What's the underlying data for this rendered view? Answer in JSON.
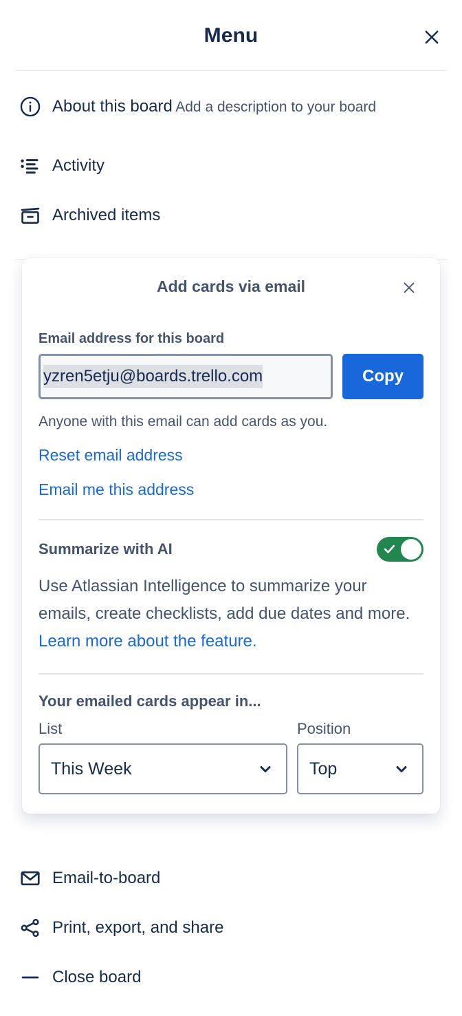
{
  "header": {
    "title": "Menu",
    "close_icon": "close-icon"
  },
  "menu": {
    "items_top": [
      {
        "icon": "info-circle-icon",
        "label": "About this board",
        "sublabel": "Add a description to your board"
      },
      {
        "icon": "activity-list-icon",
        "label": "Activity"
      },
      {
        "icon": "archive-box-icon",
        "label": "Archived items"
      }
    ],
    "items_bottom": [
      {
        "icon": "envelope-icon",
        "label": "Email-to-board"
      },
      {
        "icon": "share-icon",
        "label": "Print, export, and share"
      },
      {
        "icon": "minus-icon",
        "label": "Close board"
      }
    ]
  },
  "popover": {
    "title": "Add cards via email",
    "close_icon": "close-icon",
    "email_field": {
      "label": "Email address for this board",
      "value": "yzren5etju@boards.trello.com",
      "selected": true
    },
    "copy_button": "Copy",
    "helper_text": "Anyone with this email can add cards as you.",
    "links": [
      "Reset email address",
      "Email me this address"
    ],
    "ai": {
      "title": "Summarize with AI",
      "toggle_state": "on",
      "description_before": "Use Atlassian Intelligence to summarize your emails, create checklists, add due dates and more. ",
      "description_link": "Learn more about the feature."
    },
    "appear_in": {
      "title": "Your emailed cards appear in...",
      "list": {
        "label": "List",
        "value": "This Week",
        "chevron_icon": "chevron-down-icon"
      },
      "position": {
        "label": "Position",
        "value": "Top",
        "chevron_icon": "chevron-down-icon"
      }
    }
  },
  "colors": {
    "accent_blue": "#1868db",
    "toggle_green": "#22874e",
    "text_dark": "#172b4d",
    "text_muted": "#44546f",
    "border": "#8590a2"
  }
}
